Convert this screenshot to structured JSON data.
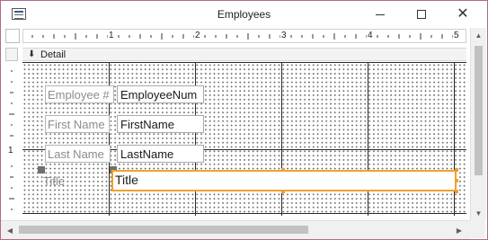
{
  "window": {
    "title": "Employees",
    "icons": {
      "app": "form-icon",
      "minimize": "minimize-icon",
      "maximize": "maximize-icon",
      "close": "close-icon"
    }
  },
  "ruler": {
    "horizontal_numbers": [
      "1",
      "2",
      "3",
      "4",
      "5"
    ],
    "vertical_numbers": [
      "1"
    ]
  },
  "section": {
    "name": "Detail",
    "icon": "arrow-down-icon"
  },
  "controls": {
    "employee_label": "Employee #",
    "employee_field": "EmployeeNum",
    "firstname_label": "First Name",
    "firstname_field": "FirstName",
    "lastname_label": "Last Name",
    "lastname_field": "LastName",
    "title_label": "Title",
    "title_field": "Title"
  },
  "colors": {
    "selection": "#f0a030",
    "window_border": "#b36a89",
    "grid_line": "#2a2a2a"
  }
}
